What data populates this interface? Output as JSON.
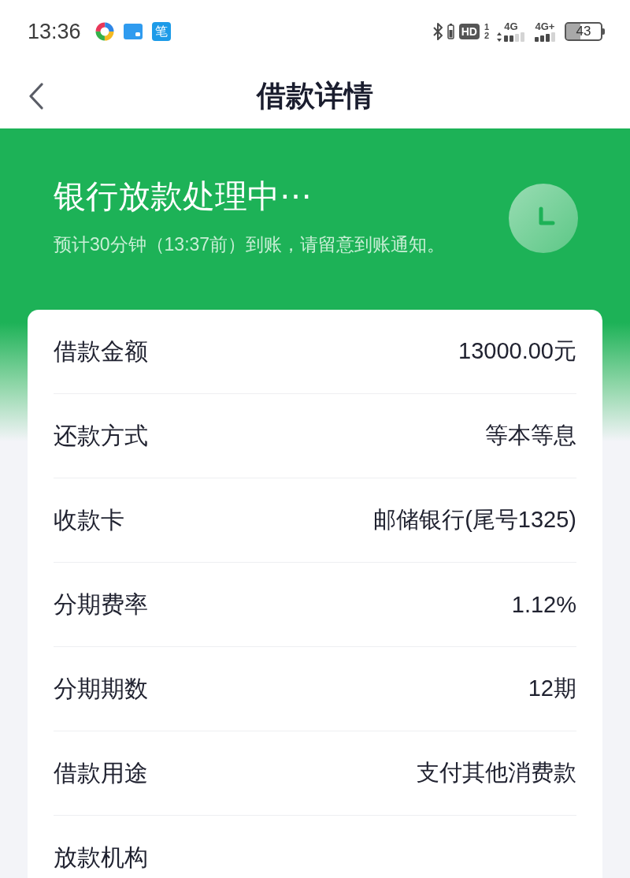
{
  "status_bar": {
    "time": "13:36",
    "app_tile_label": "笔",
    "hd_label": "HD",
    "sim_labels": [
      "1",
      "2"
    ],
    "networks": [
      {
        "type": "4G",
        "kind": "arrows"
      },
      {
        "type": "4G+",
        "kind": "plain"
      }
    ],
    "battery": "43"
  },
  "nav": {
    "title": "借款详情"
  },
  "status": {
    "heading": "银行放款处理中⋯",
    "note": "预计30分钟（13:37前）到账，请留意到账通知。"
  },
  "details": [
    {
      "label": "借款金额",
      "value": "13000.00元"
    },
    {
      "label": "还款方式",
      "value": "等本等息"
    },
    {
      "label": "收款卡",
      "value": "邮储银行(尾号1325)"
    },
    {
      "label": "分期费率",
      "value": "1.12%"
    },
    {
      "label": "分期期数",
      "value": "12期"
    },
    {
      "label": "借款用途",
      "value": "支付其他消费款"
    },
    {
      "label": "放款机构"
    }
  ]
}
